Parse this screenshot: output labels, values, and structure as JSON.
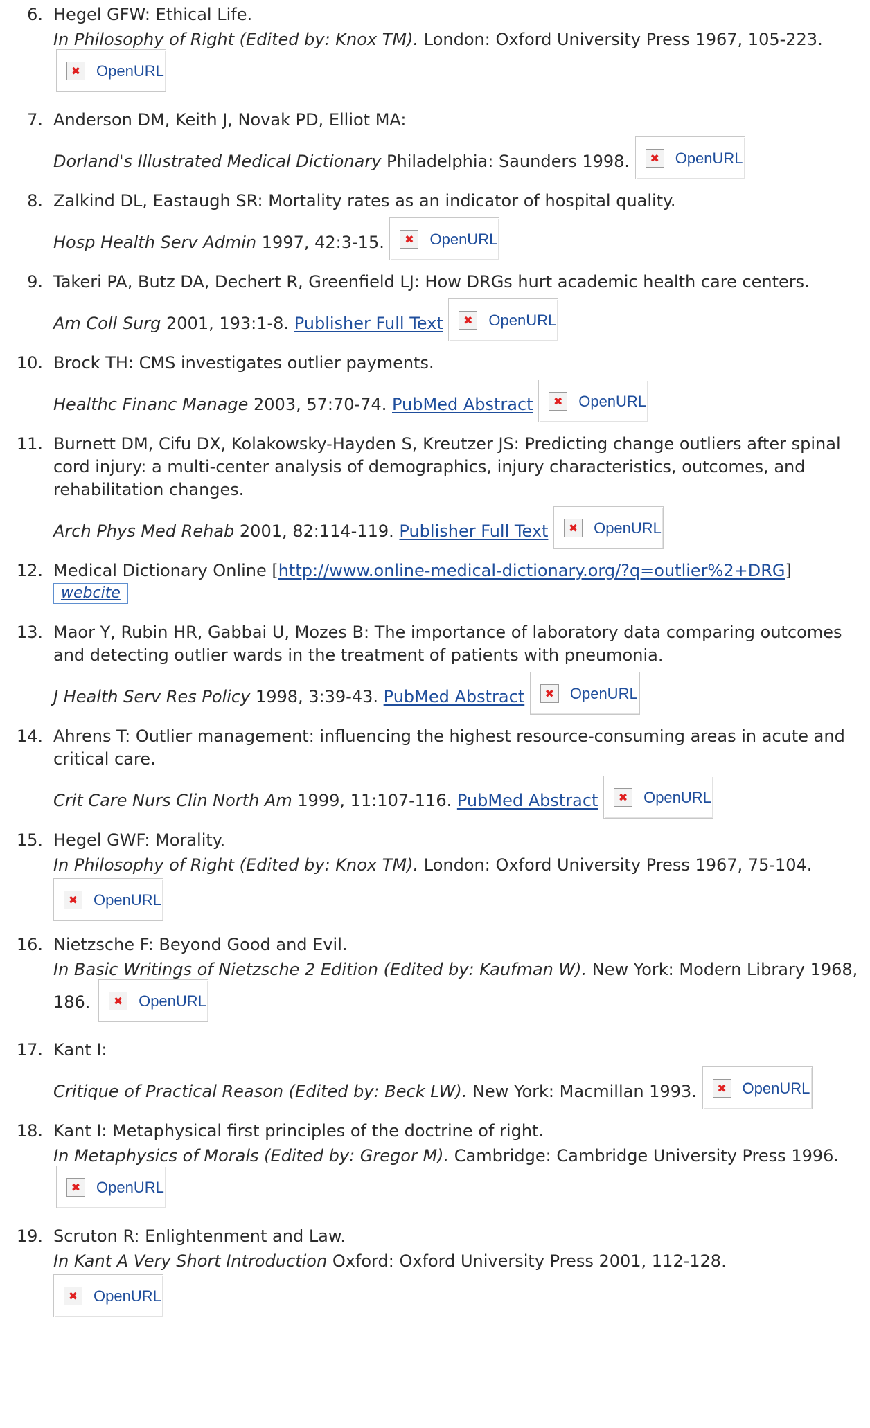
{
  "openurl_label": "OpenURL",
  "colors": {
    "text": "#2b2b2b",
    "link": "#1f4e9c",
    "icon_x": "#e02020"
  },
  "references": [
    {
      "num": "6.",
      "title": "Hegel GFW: Ethical Life.",
      "italic": "In Philosophy of Right (Edited by: Knox TM).",
      "rest": " London: Oxford University Press 1967, 105-223.",
      "link": "",
      "openurl": true
    },
    {
      "num": "7.",
      "title": "Anderson DM, Keith J, Novak PD, Elliot MA:",
      "italic": "Dorland's Illustrated Medical Dictionary",
      "rest": " Philadelphia: Saunders 1998.",
      "link": "",
      "openurl": true
    },
    {
      "num": "8.",
      "title": "Zalkind DL, Eastaugh SR: Mortality rates as an indicator of hospital quality.",
      "italic": "Hosp Health Serv Admin",
      "rest": " 1997, 42:3-15.",
      "link": "",
      "openurl": true
    },
    {
      "num": "9.",
      "title": "Takeri PA, Butz DA, Dechert R, Greenfield LJ: How DRGs hurt academic health care centers.",
      "italic": "Am Coll Surg",
      "rest": " 2001, 193:1-8.",
      "link": "Publisher Full Text",
      "openurl": true
    },
    {
      "num": "10.",
      "title": "Brock TH: CMS investigates outlier payments.",
      "italic": "Healthc Financ Manage",
      "rest": " 2003, 57:70-74.",
      "link": "PubMed Abstract",
      "openurl": true
    },
    {
      "num": "11.",
      "title": "Burnett DM, Cifu DX, Kolakowsky-Hayden S, Kreutzer JS: Predicting change outliers after spinal cord injury: a multi-center analysis of demographics, injury characteristics, outcomes, and rehabilitation changes.",
      "italic": "Arch Phys Med Rehab",
      "rest": " 2001, 82:114-119.",
      "link": "Publisher Full Text",
      "openurl": true
    },
    {
      "num": "12.",
      "title": "Medical Dictionary Online [",
      "url": "http://www.online-medical-dictionary.org/?q=outlier%2+DRG",
      "title_end": "]",
      "webcite": "webcite"
    },
    {
      "num": "13.",
      "title": "Maor Y, Rubin HR, Gabbai U, Mozes B: The importance of laboratory data comparing outcomes and detecting outlier wards in the treatment of patients with pneumonia.",
      "italic": "J Health Serv Res Policy",
      "rest": " 1998, 3:39-43.",
      "link": "PubMed Abstract",
      "openurl": true
    },
    {
      "num": "14.",
      "title": "Ahrens T: Outlier management: influencing the highest resource-consuming areas in acute and critical care.",
      "italic": "Crit Care Nurs Clin North Am",
      "rest": " 1999, 11:107-116.",
      "link": "PubMed Abstract",
      "openurl": true
    },
    {
      "num": "15.",
      "title": "Hegel GWF: Morality.",
      "italic": "In Philosophy of Right (Edited by: Knox TM).",
      "rest": " London: Oxford University Press 1967, 75-104.",
      "link": "",
      "openurl": true
    },
    {
      "num": "16.",
      "title": "Nietzsche F: Beyond Good and Evil.",
      "italic": "In Basic Writings of Nietzsche 2 Edition (Edited by: Kaufman W).",
      "rest": " New York: Modern Library 1968, 186.",
      "link": "",
      "openurl": true
    },
    {
      "num": "17.",
      "title": "Kant I:",
      "italic": "Critique of Practical Reason (Edited by: Beck LW).",
      "rest": " New York: Macmillan 1993.",
      "link": "",
      "openurl": true
    },
    {
      "num": "18.",
      "title": "Kant I: Metaphysical first principles of the doctrine of right.",
      "italic": "In Metaphysics of Morals (Edited by: Gregor M).",
      "rest": " Cambridge: Cambridge University Press 1996.",
      "link": "",
      "openurl": true
    },
    {
      "num": "19.",
      "title": "Scruton R: Enlightenment and Law.",
      "italic": "In Kant A Very Short Introduction",
      "rest": " Oxford: Oxford University Press 2001, 112-128.",
      "link": "",
      "openurl": true
    }
  ]
}
